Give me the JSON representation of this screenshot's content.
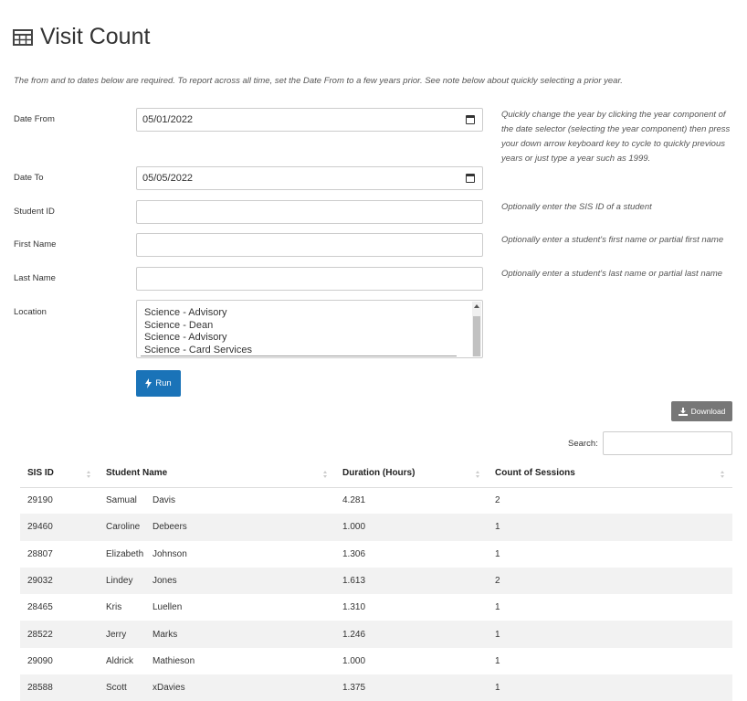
{
  "page": {
    "title": "Visit Count",
    "icon": "table-icon"
  },
  "note": "The from and to dates below are required. To report across all time, set the Date From to a few years prior. See note below about quickly selecting a prior year.",
  "form": {
    "date_from": {
      "label": "Date From",
      "value": "05/01/2022",
      "help": "Quickly change the year by clicking the year component of the date selector (selecting the year component) then press your down arrow keyboard key to cycle to quickly previous years or just type a year such as 1999."
    },
    "date_to": {
      "label": "Date To",
      "value": "05/05/2022"
    },
    "student_id": {
      "label": "Student ID",
      "value": "",
      "help": "Optionally enter the SIS ID of a student"
    },
    "first_name": {
      "label": "First Name",
      "value": "",
      "help": "Optionally enter a student's first name or partial first name"
    },
    "last_name": {
      "label": "Last Name",
      "value": "",
      "help": "Optionally enter a student's last name or partial last name"
    },
    "location": {
      "label": "Location",
      "options": [
        "Science - Advisory",
        "Science - Dean",
        "Science - Advisory",
        "Science - Card Services"
      ]
    }
  },
  "buttons": {
    "run": "Run",
    "download": "Download"
  },
  "search": {
    "label": "Search:",
    "value": ""
  },
  "table": {
    "columns": [
      "SIS ID",
      "Student Name",
      "Duration (Hours)",
      "Count of Sessions"
    ],
    "rows": [
      {
        "sis_id": "29190",
        "first": "Samual",
        "last": "Davis",
        "duration": "4.281",
        "count": "2"
      },
      {
        "sis_id": "29460",
        "first": "Caroline",
        "last": "Debeers",
        "duration": "1.000",
        "count": "1"
      },
      {
        "sis_id": "28807",
        "first": "Elizabeth",
        "last": "Johnson",
        "duration": "1.306",
        "count": "1"
      },
      {
        "sis_id": "29032",
        "first": "Lindey",
        "last": "Jones",
        "duration": "1.613",
        "count": "2"
      },
      {
        "sis_id": "28465",
        "first": "Kris",
        "last": "Luellen",
        "duration": "1.310",
        "count": "1"
      },
      {
        "sis_id": "28522",
        "first": "Jerry",
        "last": "Marks",
        "duration": "1.246",
        "count": "1"
      },
      {
        "sis_id": "29090",
        "first": "Aldrick",
        "last": "Mathieson",
        "duration": "1.000",
        "count": "1"
      },
      {
        "sis_id": "28588",
        "first": "Scott",
        "last": "xDavies",
        "duration": "1.375",
        "count": "1"
      }
    ]
  },
  "colors": {
    "primary": "#1a73b8",
    "secondary": "#777777",
    "row_stripe": "#f2f2f2"
  }
}
